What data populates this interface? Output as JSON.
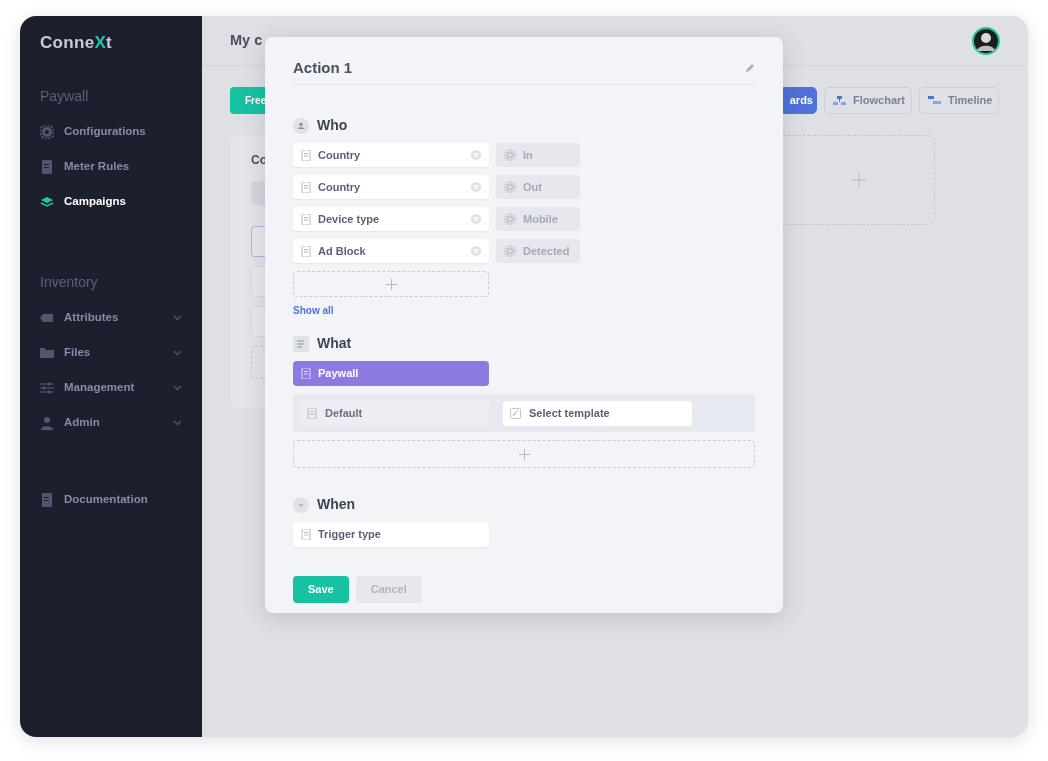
{
  "sidebar": {
    "logo": [
      {
        "text": "Conne",
        "color": "#c9ccd8"
      },
      {
        "text": "X",
        "color": "#1ec8a5"
      },
      {
        "text": "t",
        "color": "#c9ccd8"
      }
    ],
    "sections": [
      {
        "title": "Paywall",
        "items": [
          {
            "label": "Configurations",
            "selected": false,
            "expandable": false
          },
          {
            "label": "Meter Rules",
            "selected": false,
            "expandable": false
          },
          {
            "label": "Campaigns",
            "selected": true,
            "expandable": false
          }
        ]
      },
      {
        "title": "Inventory",
        "items": [
          {
            "label": "Attributes",
            "selected": false,
            "expandable": true
          },
          {
            "label": "Files",
            "selected": false,
            "expandable": true
          },
          {
            "label": "Management",
            "selected": false,
            "expandable": true
          },
          {
            "label": "Admin",
            "selected": false,
            "expandable": true
          }
        ]
      }
    ],
    "footer_item": {
      "label": "Documentation"
    }
  },
  "main": {
    "page_title": "My c",
    "free_button": "Free",
    "view_buttons": [
      {
        "label": "ards",
        "selected": true
      },
      {
        "label": "Flowchart",
        "selected": false
      },
      {
        "label": "Timeline",
        "selected": false
      }
    ],
    "card": {
      "title": "Co",
      "items": [
        {
          "selected": true
        },
        {
          "selected": false
        },
        {
          "selected": false
        }
      ]
    }
  },
  "modal": {
    "title": "Action 1",
    "who": {
      "title": "Who",
      "conditions": [
        {
          "field": "Country",
          "value": "In"
        },
        {
          "field": "Country",
          "value": "Out"
        },
        {
          "field": "Device type",
          "value": "Mobile"
        },
        {
          "field": "Ad Block",
          "value": "Detected"
        }
      ],
      "show_all": "Show all"
    },
    "what": {
      "title": "What",
      "type": "Paywall",
      "templates": [
        {
          "label": "Default",
          "kind": "option"
        },
        {
          "label": "Select template",
          "kind": "picker"
        }
      ]
    },
    "when": {
      "title": "When",
      "trigger": "Trigger type"
    },
    "buttons": [
      {
        "label": "Save",
        "kind": "primary"
      },
      {
        "label": "Cancel",
        "kind": "secondary"
      }
    ]
  }
}
